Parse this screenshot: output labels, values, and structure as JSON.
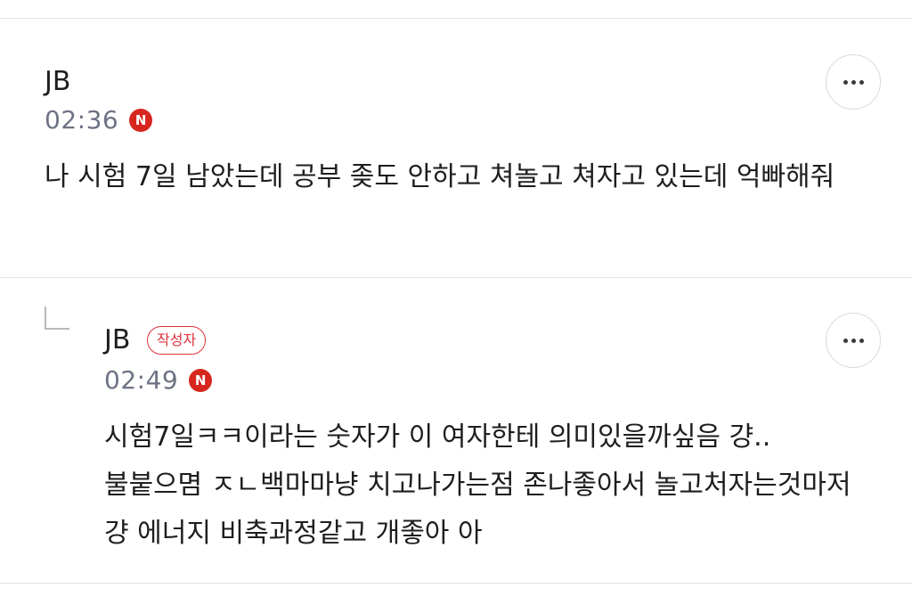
{
  "comments": [
    {
      "author": "JB",
      "time": "02:36",
      "new_badge": "N",
      "text": "나 시험 7일 남았는데 공부 좆도 안하고 쳐놀고 쳐자고 있는데 억빠해줘"
    },
    {
      "author": "JB",
      "writer_badge": "작성자",
      "time": "02:49",
      "new_badge": "N",
      "text": "시험7일ㅋㅋ이라는 숫자가 이 여자한테 의미있을까싶음 걍.. 불붙으몀 ㅈㄴ백마마냥 치고나가는점 존나좋아서 놀고처자는것마저 걍 에너지 비축과정같고 개좋아 아"
    }
  ],
  "icons": {
    "more": "more-horizontal-icon",
    "reply": "reply-arrow-icon"
  },
  "colors": {
    "badge_new": "#d7261e",
    "writer_badge": "#e0323c",
    "time": "#6e7384"
  }
}
